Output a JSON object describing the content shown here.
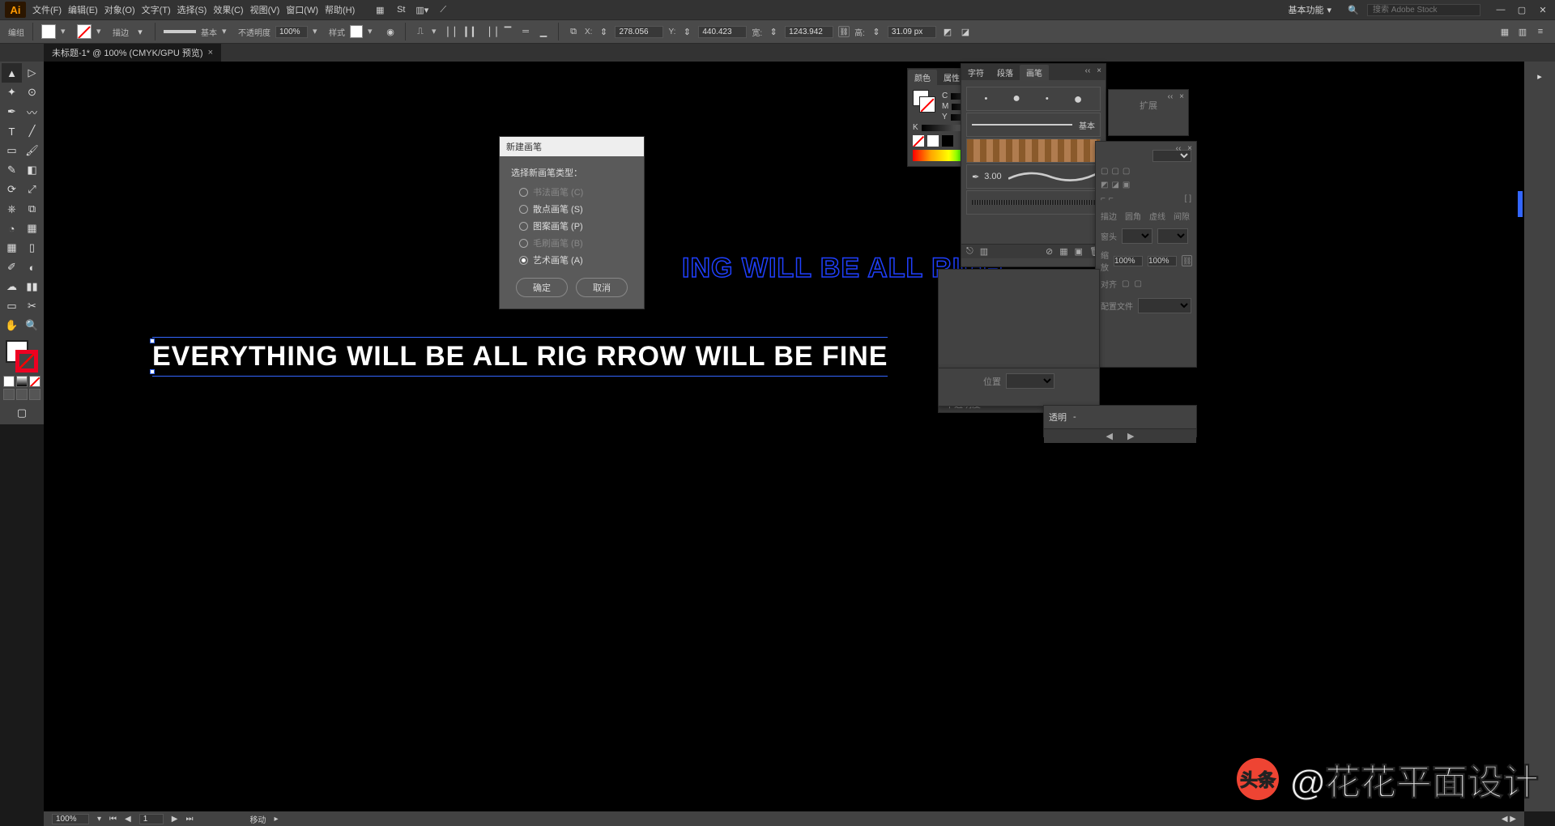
{
  "menubar": {
    "logo": "Ai",
    "items": [
      "文件(F)",
      "编辑(E)",
      "对象(O)",
      "文字(T)",
      "选择(S)",
      "效果(C)",
      "视图(V)",
      "窗口(W)",
      "帮助(H)"
    ],
    "workspace_label": "基本功能",
    "search_placeholder": "搜索 Adobe Stock"
  },
  "controlbar": {
    "mode": "编组",
    "stroke_label": "描边",
    "stroke_style": "基本",
    "opacity_label": "不透明度",
    "opacity_value": "100%",
    "style_label": "样式",
    "x_label": "X:",
    "x_value": "278.056",
    "y_label": "Y:",
    "y_value": "440.423",
    "w_label": "宽:",
    "w_value": "1243.942",
    "h_label": "高:",
    "h_value": "31.09 px"
  },
  "tabs": {
    "doc_title": "未标题-1* @ 100% (CMYK/GPU 预览)"
  },
  "canvas": {
    "blue_line": "ING WILL BE ALL RIGH",
    "white_line": "EVERYTHING WILL BE ALL RIG              RROW WILL BE FINE"
  },
  "dialog": {
    "title": "新建画笔",
    "prompt": "选择新画笔类型：",
    "opts": [
      {
        "label": "书法画笔 (C)",
        "disabled": true,
        "checked": false
      },
      {
        "label": "散点画笔 (S)",
        "disabled": false,
        "checked": false
      },
      {
        "label": "图案画笔 (P)",
        "disabled": false,
        "checked": false
      },
      {
        "label": "毛刷画笔 (B)",
        "disabled": true,
        "checked": false
      },
      {
        "label": "艺术画笔 (A)",
        "disabled": false,
        "checked": true
      }
    ],
    "ok": "确定",
    "cancel": "取消"
  },
  "panels": {
    "color": {
      "tabs": [
        "颜色",
        "属性"
      ],
      "channels": [
        "C",
        "M",
        "Y",
        "K"
      ]
    },
    "brush": {
      "tabs": [
        "字符",
        "段落",
        "画笔"
      ],
      "basic_label": "基本",
      "cal_value": "3.00"
    },
    "transparency": {
      "label": "透明",
      "value": "-"
    },
    "panel4_labels": {
      "r1": "扩展",
      "r2a": "窗头",
      "r2b": "",
      "r3a": "缩放",
      "r3b": "100%",
      "r3c": "100%",
      "r4": "对齐",
      "r5": "配置文件"
    }
  },
  "statusbar": {
    "zoom": "100%",
    "page": "1",
    "tool": "移动"
  },
  "watermark": {
    "brand": "头条",
    "text": "@花花平面设计"
  }
}
